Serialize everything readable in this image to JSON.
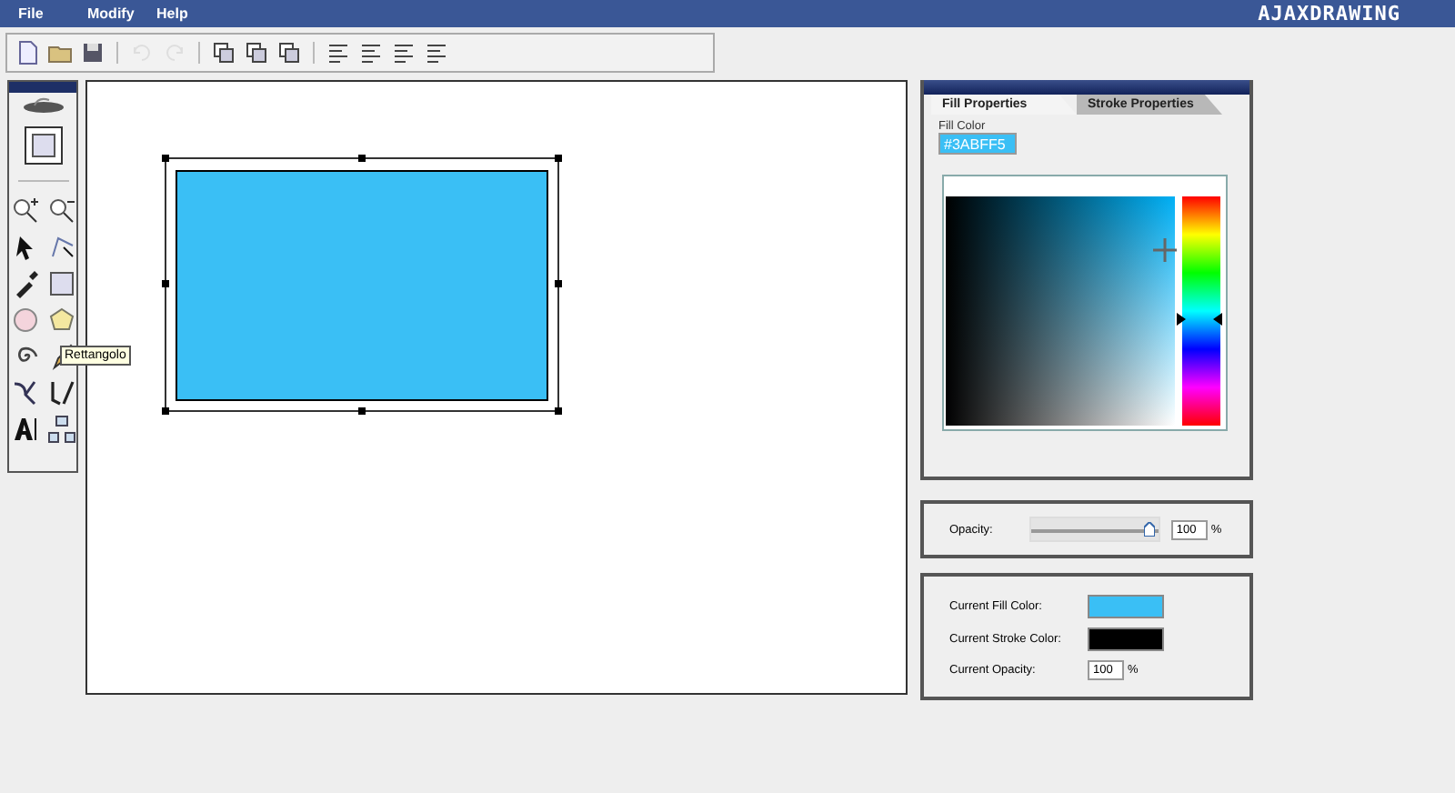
{
  "menu": [
    {
      "label": "File"
    },
    {
      "label": "Modify"
    },
    {
      "label": "Help"
    }
  ],
  "logo": "AJAXDRAWING",
  "toolbar": [
    {
      "kind": "new",
      "disabled": false
    },
    {
      "kind": "open",
      "disabled": false
    },
    {
      "kind": "save",
      "disabled": false
    },
    {
      "kind": "sep"
    },
    {
      "kind": "undo",
      "disabled": true
    },
    {
      "kind": "redo",
      "disabled": true
    },
    {
      "kind": "sep"
    },
    {
      "kind": "layer",
      "disabled": false
    },
    {
      "kind": "layer",
      "disabled": false
    },
    {
      "kind": "layer",
      "disabled": false
    },
    {
      "kind": "sep"
    },
    {
      "kind": "align",
      "disabled": false
    },
    {
      "kind": "align",
      "disabled": false
    },
    {
      "kind": "align",
      "disabled": false
    },
    {
      "kind": "align",
      "disabled": false
    }
  ],
  "tools": [
    {
      "kind": "zoom-in"
    },
    {
      "kind": "zoom-out"
    },
    {
      "kind": "pointer"
    },
    {
      "kind": "node"
    },
    {
      "kind": "eyedropper"
    },
    {
      "kind": "rect"
    },
    {
      "kind": "ellipse"
    },
    {
      "kind": "polygon"
    },
    {
      "kind": "spiral"
    },
    {
      "kind": "pencil"
    },
    {
      "kind": "pen"
    },
    {
      "kind": "brush"
    },
    {
      "kind": "text"
    },
    {
      "kind": "group"
    }
  ],
  "tooltip": "Rettangolo",
  "tabs": [
    {
      "label": "Fill Properties",
      "selected": true
    },
    {
      "label": "Stroke Properties",
      "selected": false
    }
  ],
  "fill_color": {
    "label": "Fill Color",
    "value": "#3ABFF5"
  },
  "opacity": {
    "label": "Opacity:",
    "level": 1,
    "value": "100",
    "unit": "%"
  },
  "current": {
    "fill_label": "Current Fill Color:",
    "stroke_label": "Current Stroke Color:",
    "opacity_label": "Current Opacity:",
    "opacity_value": "100",
    "unit": "%"
  }
}
